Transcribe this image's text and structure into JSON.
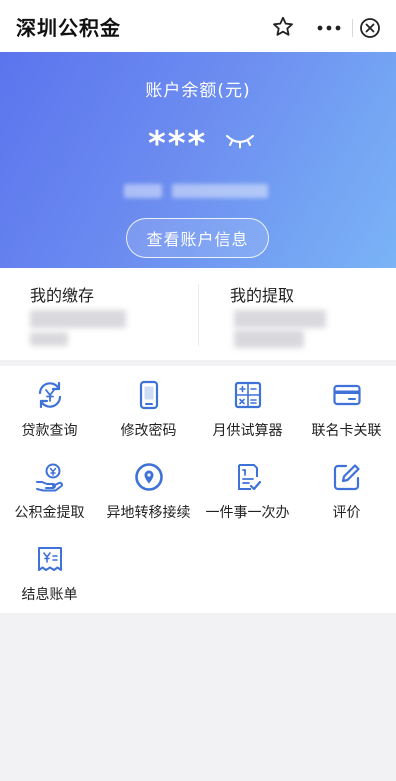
{
  "nav": {
    "title": "深圳公积金"
  },
  "account": {
    "balance_label": "账户余额(元)",
    "balance_masked": "***",
    "view_button": "查看账户信息"
  },
  "summary": {
    "deposit_label": "我的缴存",
    "withdraw_label": "我的提取"
  },
  "services": {
    "items": [
      {
        "label": "贷款查询",
        "icon": "loan-exchange-icon"
      },
      {
        "label": "修改密码",
        "icon": "phone-icon"
      },
      {
        "label": "月供试算器",
        "icon": "calculator-icon"
      },
      {
        "label": "联名卡关联",
        "icon": "card-icon"
      },
      {
        "label": "公积金提取",
        "icon": "hand-coin-icon"
      },
      {
        "label": "异地转移接续",
        "icon": "location-icon"
      },
      {
        "label": "一件事一次办",
        "icon": "checklist-icon"
      },
      {
        "label": "评价",
        "icon": "edit-icon"
      },
      {
        "label": "结息账单",
        "icon": "bill-icon"
      }
    ]
  },
  "colors": {
    "accent": "#3f72d8",
    "hero_start": "#5b74ee",
    "hero_end": "#7ab4f6"
  }
}
